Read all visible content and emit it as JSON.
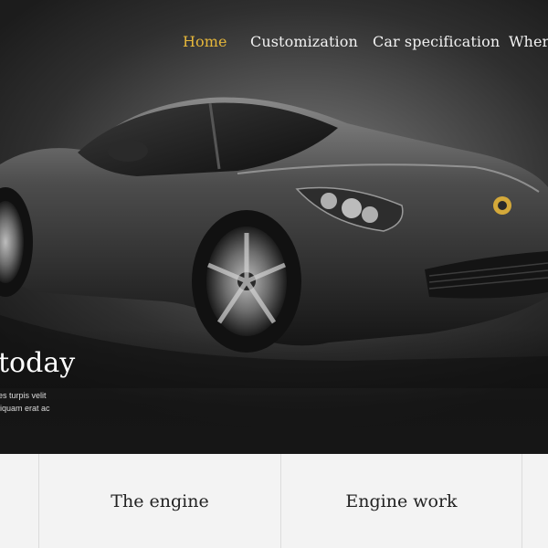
{
  "nav": {
    "items": [
      {
        "label": "Home",
        "active": true
      },
      {
        "label": "Customization",
        "active": false
      },
      {
        "label": "Car specification",
        "active": false
      },
      {
        "label": "Where",
        "active": false
      }
    ],
    "active_color": "#e6b73a"
  },
  "hero": {
    "title": "today",
    "lines": [
      "es turpis velit",
      "liquam erat ac"
    ]
  },
  "cards": [
    {
      "label": ""
    },
    {
      "label": "The engine"
    },
    {
      "label": "Engine work"
    },
    {
      "label": ""
    }
  ]
}
